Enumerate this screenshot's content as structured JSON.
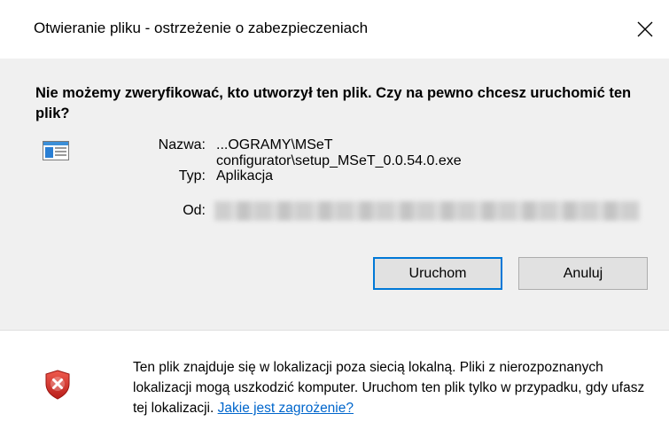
{
  "window": {
    "title": "Otwieranie pliku - ostrzeżenie o zabezpieczeniach",
    "close_glyph": "✕"
  },
  "headline": "Nie możemy zweryfikować, kto utworzył ten plik. Czy na pewno chcesz uruchomić ten plik?",
  "file_info": {
    "icon": "application-file-icon",
    "name_label": "Nazwa:",
    "name_value": "...OGRAMY\\MSeT configurator\\setup_MSeT_0.0.54.0.exe",
    "type_label": "Typ:",
    "type_value": "Aplikacja",
    "from_label": "Od:"
  },
  "buttons": {
    "run_label": "Uruchom",
    "cancel_label": "Anuluj"
  },
  "footer": {
    "icon": "shield-warning-icon",
    "text": "Ten plik znajduje się w lokalizacji poza siecią lokalną. Pliki z nierozpoznanych lokalizacji mogą uszkodzić komputer. Uruchom ten plik tylko w przypadku, gdy ufasz tej lokalizacji.",
    "link_text": "Jakie jest zagrożenie?"
  },
  "colors": {
    "accent": "#0078d7",
    "link": "#0066cc",
    "shield_red": "#d9302a"
  }
}
